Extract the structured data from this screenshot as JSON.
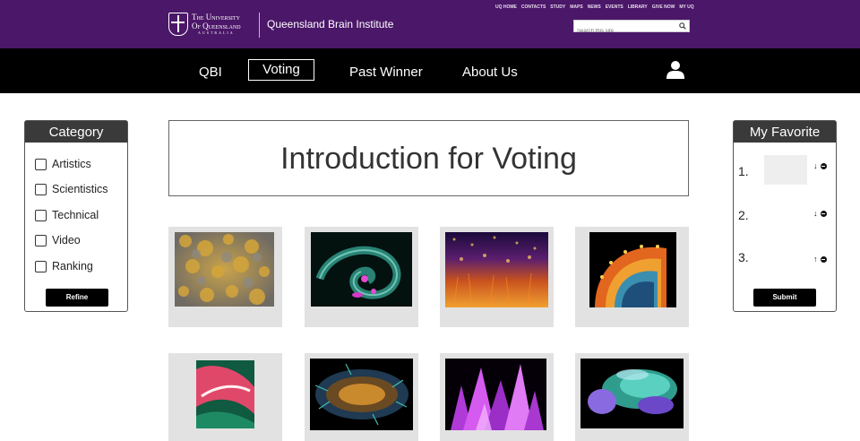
{
  "header": {
    "university_line1": "The University",
    "university_line2": "Of Queensland",
    "university_line3": "AUSTRALIA",
    "site_name": "Queensland Brain Institute",
    "utility_links": [
      "UQ HOME",
      "CONTACTS",
      "STUDY",
      "MAPS",
      "NEWS",
      "EVENTS",
      "LIBRARY",
      "GIVE NOW",
      "MY UQ"
    ],
    "search_placeholder": "Search this site",
    "search_icon": "search-icon",
    "brand_color": "#4b1768"
  },
  "nav": {
    "items": [
      "QBI",
      "Voting",
      "Past Winner",
      "About Us"
    ],
    "active": "Voting",
    "user_icon": "user-icon"
  },
  "category": {
    "title": "Category",
    "items": [
      "Artistics",
      "Scientistics",
      "Technical",
      "Video",
      "Ranking"
    ],
    "refine_label": "Refine"
  },
  "main": {
    "title": "Introduction for Voting",
    "gallery": [
      {
        "name": "gold-texture-image"
      },
      {
        "name": "spiral-embryo-image"
      },
      {
        "name": "orange-cells-image"
      },
      {
        "name": "orange-fan-image"
      },
      {
        "name": "red-tissue-image"
      },
      {
        "name": "neuron-cluster-image"
      },
      {
        "name": "purple-crystal-image"
      },
      {
        "name": "brain-scan-image"
      }
    ]
  },
  "favorites": {
    "title": "My Favorite",
    "rows": [
      {
        "number": "1.",
        "arrow": "↓"
      },
      {
        "number": "2.",
        "arrow": "↓"
      },
      {
        "number": "3.",
        "arrow": "↑"
      }
    ],
    "submit_label": "Submit"
  }
}
